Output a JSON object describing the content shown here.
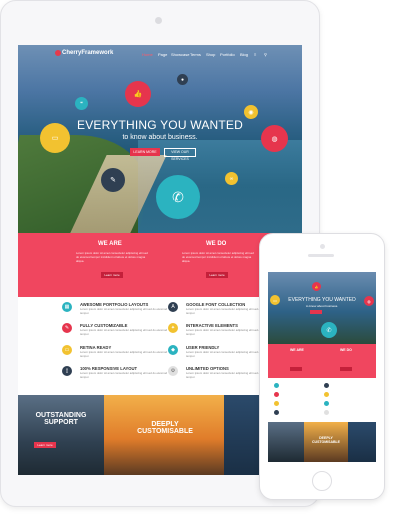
{
  "brand": {
    "logo_text": "CherryFramework"
  },
  "nav": {
    "items": [
      "Home",
      "Page",
      "Showcase",
      "Terms",
      "Shop",
      "Portfolio",
      "Blog",
      "≡",
      "⚲"
    ]
  },
  "hero": {
    "title": "EVERYTHING YOU WANTED",
    "subtitle": "to know about business.",
    "btn_primary": "LEARN MORE",
    "btn_secondary": "VIEW OUR SERVICES"
  },
  "band": {
    "we_are": "WE ARE",
    "we_do": "WE DO",
    "we_are_text": "Lorem ipsum dolor sit amet consectetur adipiscing elit sed do eiusmod tempor incididunt ut labore et dolore magna aliqua.",
    "we_do_text": "Lorem ipsum dolor sit amet consectetur adipiscing elit sed do eiusmod tempor incididunt ut labore et dolore magna aliqua.",
    "btn": "Learn more"
  },
  "features": [
    {
      "title": "AWESOME PORTFOLIO LAYOUTS",
      "icon": "grid-icon",
      "color": "#2bb3c0"
    },
    {
      "title": "GOOGLE FONT COLLECTION",
      "icon": "font-icon",
      "color": "#2f3f52"
    },
    {
      "title": "FULLY CUSTOMIZABLE",
      "icon": "brush-icon",
      "color": "#e6354d"
    },
    {
      "title": "INTERACTIVE ELEMENTS",
      "icon": "bulb-icon",
      "color": "#f2c230"
    },
    {
      "title": "RETINA READY",
      "icon": "monitor-icon",
      "color": "#f2c230"
    },
    {
      "title": "USER FRIENDLY",
      "icon": "drop-icon",
      "color": "#2bb3c0"
    },
    {
      "title": "100% RESPONSIVE LAYOUT",
      "icon": "mobile-icon",
      "color": "#2f3f52"
    },
    {
      "title": "UNLIMITED OPTIONS",
      "icon": "gear-icon",
      "color": "#e0e0e0"
    }
  ],
  "feature_desc": "Lorem ipsum dolor sit amet consectetur adipiscing elit sed do eiusmod tempor.",
  "photos": {
    "outstanding": "OUTSTANDING SUPPORT",
    "deeply": "DEEPLY CUSTOMISABLE",
    "btn": "Learn more"
  },
  "phone": {
    "title": "EVERYTHING YOU WANTED",
    "subtitle": "to know about business.",
    "we_are": "WE ARE",
    "we_do": "WE DO",
    "deeply": "DEEPLY CUSTOMISABLE"
  },
  "colors": {
    "accent": "#f0465f",
    "teal": "#2bb3c0",
    "yellow": "#f2c230",
    "navy": "#2f3f52"
  }
}
